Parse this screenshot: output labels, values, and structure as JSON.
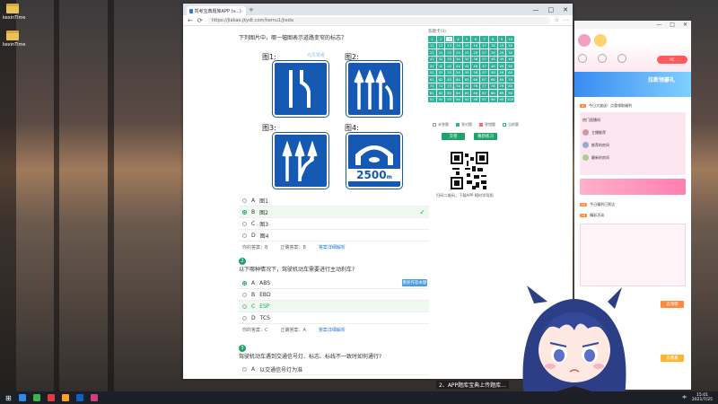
{
  "desktop": {
    "icons": [
      {
        "label": "kexinTime"
      },
      {
        "label": "kexinTime"
      }
    ]
  },
  "browser": {
    "tab_title": "驾考宝典题库APP (v...) - 一键宝典",
    "new_tab": "+",
    "window_controls": [
      "—",
      "□",
      "✕"
    ],
    "url": "https://jiakao.jkydt.com/kemu1/jieda",
    "nav": {
      "back": "←",
      "refresh": "⟳"
    },
    "tools": [
      "☆",
      "⋯"
    ]
  },
  "question1": {
    "prompt": "下列图片中，哪一幅图表示道路变窄的标志？",
    "watermark": "元贝驾考",
    "figures": [
      {
        "label": "图1:"
      },
      {
        "label": "图2:"
      },
      {
        "label": "图3:"
      },
      {
        "label": "图4:"
      }
    ],
    "sign4_text": "2500",
    "sign4_unit": "m",
    "options": [
      {
        "key": "A",
        "text": "图1"
      },
      {
        "key": "B",
        "text": "图2"
      },
      {
        "key": "C",
        "text": "图3"
      },
      {
        "key": "D",
        "text": "图4"
      }
    ],
    "check_mark": "✓",
    "answer": {
      "yours": "你的答案：B",
      "correct": "正确答案：B",
      "explain": "答案详细解析"
    }
  },
  "question2": {
    "num": "2",
    "prompt": "以下哪种情况下，驾驶机动车需要进行主动刹车?",
    "options": [
      {
        "key": "A",
        "text": "ABS"
      },
      {
        "key": "B",
        "text": "EBD"
      },
      {
        "key": "C",
        "text": "ESP"
      },
      {
        "key": "D",
        "text": "TCS"
      }
    ],
    "answer": {
      "yours": "你的答案：C",
      "correct": "正确答案：A",
      "explain": "答案详细解析"
    },
    "action_label": "重新作答本题"
  },
  "question3": {
    "num": "3",
    "prompt": "驾驶机动车遇到交通信号灯、标志、标线不一致时如何通行?",
    "options": [
      {
        "key": "A",
        "text": "以交通信号灯为准"
      }
    ]
  },
  "sheet": {
    "title": "答题卡(3)",
    "numbers": [
      "1",
      "2",
      "3",
      "4",
      "5",
      "6",
      "7",
      "8",
      "9",
      "10",
      "11",
      "12",
      "13",
      "14",
      "15",
      "16",
      "17",
      "18",
      "19",
      "20",
      "21",
      "22",
      "23",
      "24",
      "25",
      "26",
      "27",
      "28",
      "29",
      "30",
      "31",
      "32",
      "33",
      "34",
      "35",
      "36",
      "37",
      "38",
      "39",
      "40",
      "41",
      "42",
      "43",
      "44",
      "45",
      "46",
      "47",
      "48",
      "49",
      "50",
      "51",
      "52",
      "53",
      "54",
      "55",
      "56",
      "57",
      "58",
      "59",
      "60",
      "61",
      "62",
      "63",
      "64",
      "65",
      "66",
      "67",
      "68",
      "69",
      "70",
      "71",
      "72",
      "73",
      "74",
      "75",
      "76",
      "77",
      "78",
      "79",
      "80",
      "81",
      "82",
      "83",
      "84",
      "85",
      "86",
      "87",
      "88",
      "89",
      "90",
      "91",
      "92",
      "93",
      "94",
      "95",
      "96",
      "97",
      "98",
      "99",
      "100"
    ],
    "legend": [
      "未答题",
      "答对题",
      "答错题",
      "当前题"
    ],
    "buttons": {
      "submit": "交卷",
      "restart": "重新练习"
    },
    "qr_caption": "扫码二维码，下载APP 随时学驾照"
  },
  "app": {
    "win_controls": [
      "—",
      "□",
      "✕"
    ],
    "banner": "拉新领豪礼",
    "rows": [
      "今日大放送！点我领取福利",
      "热门直播间",
      "主播推荐",
      "推荐的房间",
      "最新的房间",
      "今日福利已到达",
      "精彩活动"
    ],
    "side_btn": "去领取",
    "bottom_btn": "去看看"
  },
  "taskbar": {
    "time": "15:01",
    "date": "2021/7/25",
    "lang": "中"
  },
  "bottom_hint": "2、APP题库宝典上传题库..."
}
